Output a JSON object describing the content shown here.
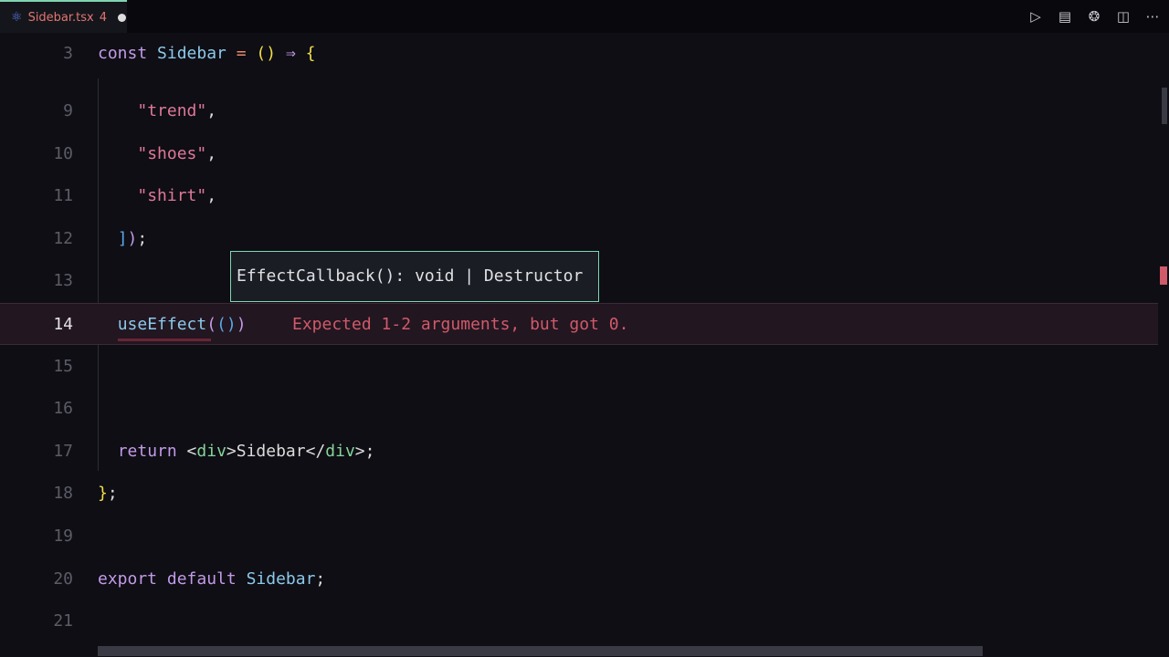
{
  "tab": {
    "icon": "react-icon",
    "filename": "Sidebar.tsx",
    "problems": "4",
    "modified": true
  },
  "actions": [
    {
      "name": "run-icon",
      "glyph": "▷"
    },
    {
      "name": "preview-icon",
      "glyph": "▤"
    },
    {
      "name": "copilot-icon",
      "glyph": "❂"
    },
    {
      "name": "split-editor-icon",
      "glyph": "◫"
    },
    {
      "name": "more-icon",
      "glyph": "⋯"
    }
  ],
  "sticky": {
    "num": "3",
    "tokens": [
      [
        "kw",
        "const "
      ],
      [
        "fn",
        "Sidebar "
      ],
      [
        "op",
        "= "
      ],
      [
        "yl",
        "() "
      ],
      [
        "pu",
        "⇒ "
      ],
      [
        "yl",
        "{"
      ]
    ]
  },
  "lines": [
    {
      "num": "9",
      "tokens": [
        [
          "pl",
          "    "
        ],
        [
          "str",
          "\"trend\""
        ],
        [
          "pl",
          ","
        ]
      ]
    },
    {
      "num": "10",
      "tokens": [
        [
          "pl",
          "    "
        ],
        [
          "str",
          "\"shoes\""
        ],
        [
          "pl",
          ","
        ]
      ]
    },
    {
      "num": "11",
      "tokens": [
        [
          "pl",
          "    "
        ],
        [
          "str",
          "\"shirt\""
        ],
        [
          "pl",
          ","
        ]
      ]
    },
    {
      "num": "12",
      "tokens": [
        [
          "pl",
          "  "
        ],
        [
          "bl",
          "]"
        ],
        [
          "pu",
          ")"
        ],
        [
          "pl",
          ";"
        ]
      ]
    },
    {
      "num": "13",
      "tokens": []
    },
    {
      "num": "14",
      "tokens": [
        [
          "pl",
          "  "
        ],
        [
          "fn",
          "useEffect"
        ],
        [
          "pu",
          "("
        ],
        [
          "bl",
          "()"
        ],
        [
          "pu",
          ")"
        ]
      ],
      "active": true,
      "error": "Expected 1-2 arguments, but got 0."
    },
    {
      "num": "15",
      "tokens": []
    },
    {
      "num": "16",
      "tokens": []
    },
    {
      "num": "17",
      "tokens": [
        [
          "pl",
          "  "
        ],
        [
          "kw",
          "return "
        ],
        [
          "pl",
          "<"
        ],
        [
          "tag",
          "div"
        ],
        [
          "pl",
          ">Sidebar</"
        ],
        [
          "tag",
          "div"
        ],
        [
          "pl",
          ">;"
        ]
      ]
    },
    {
      "num": "18",
      "tokens": [
        [
          "yl",
          "}"
        ],
        [
          "pl",
          ";"
        ]
      ]
    },
    {
      "num": "19",
      "tokens": []
    },
    {
      "num": "20",
      "tokens": [
        [
          "kw",
          "export default "
        ],
        [
          "fn",
          "Sidebar"
        ],
        [
          "pl",
          ";"
        ]
      ]
    },
    {
      "num": "21",
      "tokens": []
    }
  ],
  "hover": {
    "signature": "EffectCallback(): void | Destructor"
  }
}
